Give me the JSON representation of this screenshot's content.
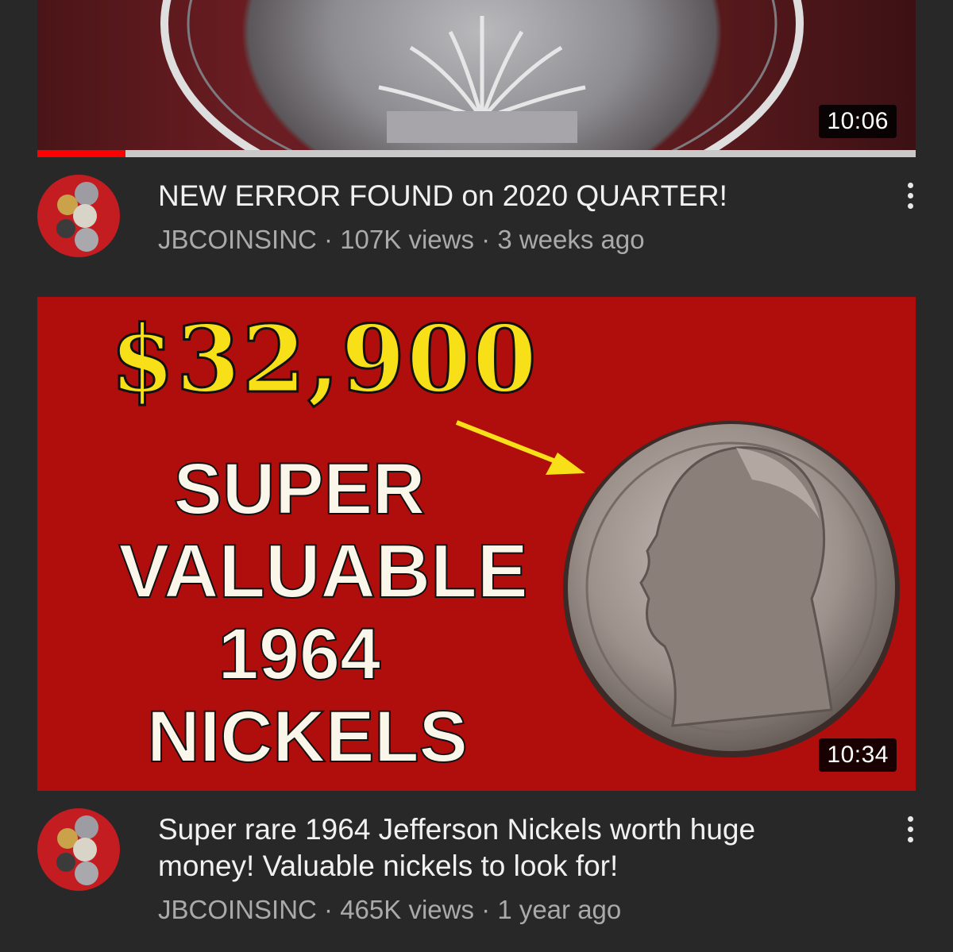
{
  "videos": [
    {
      "duration": "10:06",
      "title": "NEW ERROR FOUND on 2020 QUARTER!",
      "channel": "JBCOINSINC",
      "views": "107K views",
      "age": "3 weeks ago",
      "watch_progress": 0.1
    },
    {
      "duration": "10:34",
      "title": "Super rare 1964 Jefferson Nickels worth huge money! Valuable nickels to look for!",
      "channel": "JBCOINSINC",
      "views": "465K views",
      "age": "1 year ago",
      "thumbnail_text": {
        "price": "$32,900",
        "line1": "SUPER",
        "line2": "VALUABLE",
        "line3": "1964",
        "line4": "NICKELS"
      }
    }
  ],
  "separator": "·",
  "icons": {
    "menu": "kebab-menu-icon",
    "avatar": "channel-avatar-coins"
  },
  "colors": {
    "background": "#282828",
    "progress": "#ff0000",
    "thumb_red": "#b00d0d",
    "price_yellow": "#f7e018"
  }
}
